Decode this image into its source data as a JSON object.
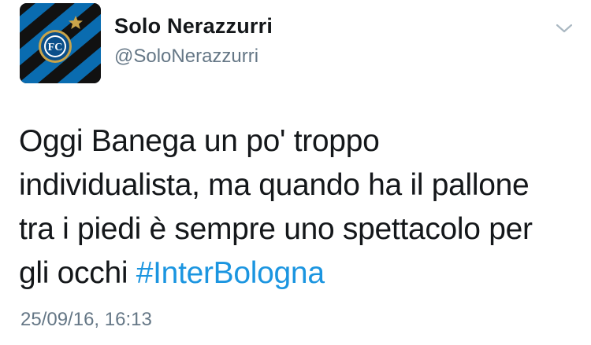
{
  "account": {
    "display_name": "Solo Nerazzurri",
    "handle": "@SoloNerazzurri"
  },
  "tweet": {
    "text_lines": [
      "Oggi Banega un po' troppo",
      "individualista, ma quando ha il pallone",
      "tra i piedi è sempre uno spettacolo per"
    ],
    "last_line_prefix": "gli occhi ",
    "hashtag": "#InterBologna",
    "timestamp": "25/09/16, 16:13"
  },
  "icons": {
    "avatar": "inter-crest-avatar-icon",
    "menu": "chevron-down-icon"
  },
  "colors": {
    "text": "#14171a",
    "secondary": "#657786",
    "link": "#1b95e0",
    "inter_blue": "#0068a8",
    "inter_black": "#111111"
  }
}
